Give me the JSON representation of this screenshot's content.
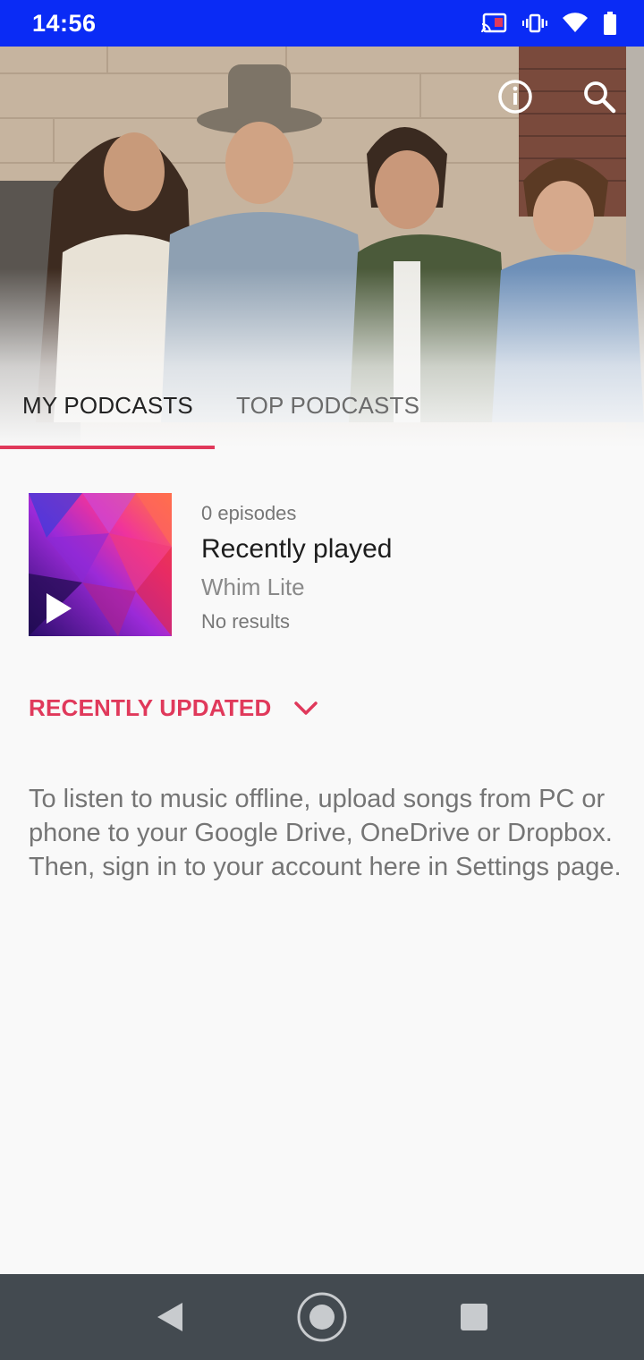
{
  "status_bar": {
    "time": "14:56",
    "icons": [
      "cast-icon",
      "vibrate-icon",
      "wifi-icon",
      "battery-icon"
    ]
  },
  "header": {
    "info_icon": "info-icon",
    "search_icon": "search-icon"
  },
  "tabs": [
    {
      "label": "MY PODCASTS",
      "selected": true
    },
    {
      "label": "TOP PODCASTS",
      "selected": false
    }
  ],
  "podcast": {
    "episodes": "0 episodes",
    "title": "Recently played",
    "source": "Whim Lite",
    "status": "No results"
  },
  "sort": {
    "label": "RECENTLY UPDATED",
    "icon": "chevron-down-icon"
  },
  "help_text": "To listen to music offline, upload songs from PC or phone to your Google Drive, OneDrive or Dropbox. Then, sign in to your account here in Settings page.",
  "colors": {
    "accent": "#e0395b",
    "status_bar": "#0a2bf5",
    "nav_bar": "#434a50"
  },
  "nav": [
    "back-icon",
    "home-icon",
    "recents-icon"
  ]
}
